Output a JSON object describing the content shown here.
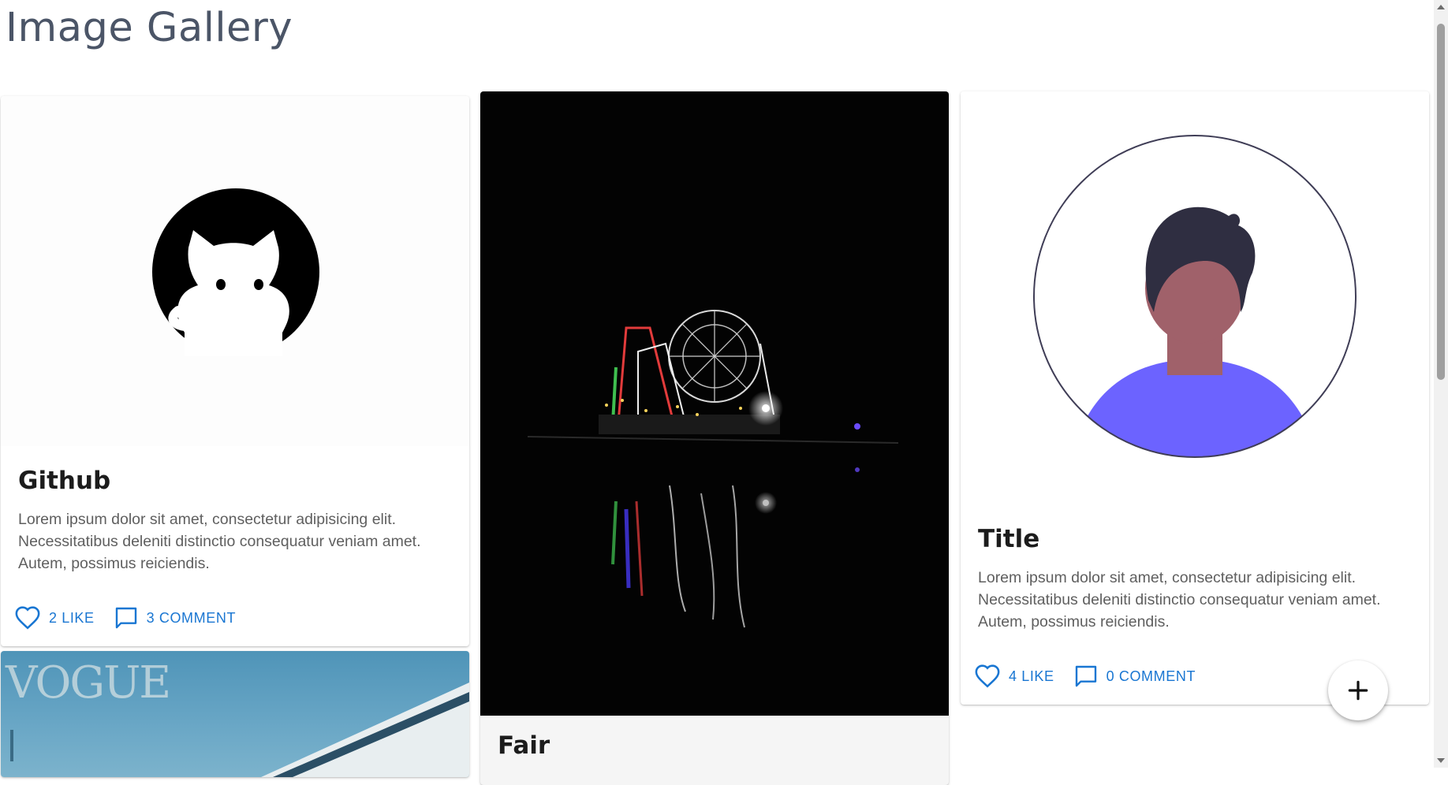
{
  "header": {
    "title": "Image Gallery"
  },
  "cards": [
    {
      "title": "Github",
      "description": "Lorem ipsum dolor sit amet, consectetur adipisicing elit. Necessitatibus deleniti distinctio consequatur veniam amet. Autem, possimus reiciendis.",
      "like_label": "2 LIKE",
      "comment_label": "3 COMMENT",
      "image": "github-octocat-logo"
    },
    {
      "title": "Fair",
      "image": "night-fair-ferris-wheel-photo"
    },
    {
      "title": "Title",
      "description": "Lorem ipsum dolor sit amet, consectetur adipisicing elit. Necessitatibus deleniti distinctio consequatur veniam amet. Autem, possimus reiciendis.",
      "like_label": "4 LIKE",
      "comment_label": "0 COMMENT",
      "image": "person-avatar-illustration"
    },
    {
      "image": "vogue-magazine-cover",
      "image_text": "VOGUE"
    }
  ],
  "fab": {
    "icon": "plus-icon"
  },
  "colors": {
    "accent": "#1976d2",
    "title": "#4b5567",
    "avatar_shirt": "#6c63ff",
    "avatar_skin": "#a0616a",
    "avatar_hair": "#2f2e41"
  }
}
